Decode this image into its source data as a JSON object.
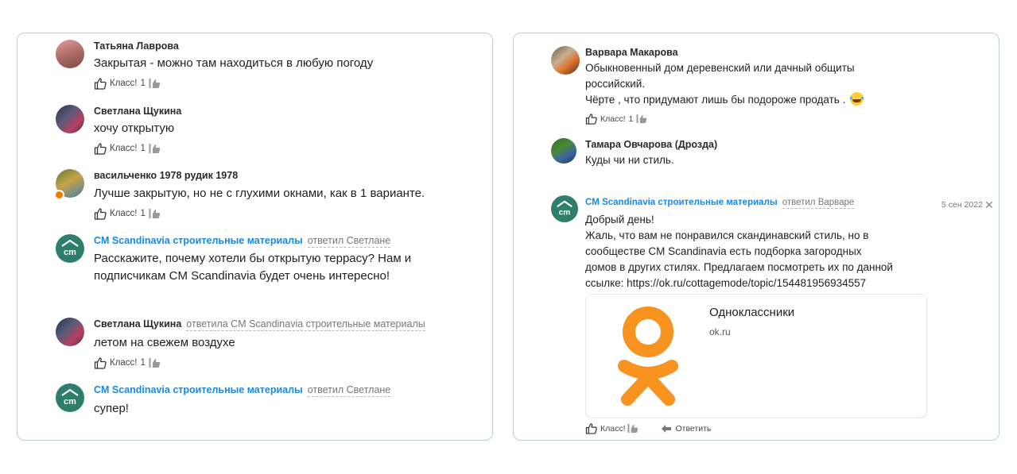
{
  "left": {
    "comments": [
      {
        "author": "Татьяна Лаврова",
        "reply_to": "",
        "text": "Закрытая - можно там находиться в любую погоду",
        "like_label": "Класс!",
        "like_count": "1"
      },
      {
        "author": "Светлана Щукина",
        "reply_to": "",
        "text": "хочу открытую",
        "like_label": "Класс!",
        "like_count": "1"
      },
      {
        "author": "васильченко 1978 рудик 1978",
        "reply_to": "",
        "text": "Лучше закрытую, но не с глухими окнами, как в 1 варианте.",
        "like_label": "Класс!",
        "like_count": "1"
      },
      {
        "author": "CM Scandinavia строительные материалы",
        "reply_to": "ответил Светлане",
        "text_lines": [
          "Расскажите, почему хотели бы открытую террасу? Нам и",
          "подписчикам CM Scandinavia будет очень интересно!"
        ]
      },
      {
        "author": "Светлана Щукина",
        "reply_to": "ответила CM Scandinavia строительные материалы",
        "text": "летом на свежем воздухе",
        "like_label": "Класс!",
        "like_count": "1"
      },
      {
        "author": "CM Scandinavia строительные материалы",
        "reply_to": "ответил Светлане",
        "text": "супер!"
      }
    ]
  },
  "right": {
    "comments": [
      {
        "author": "Варвара Макарова",
        "text_lines": [
          "Обыкновенный дом деревенский или дачный общиты",
          "российский.",
          "Чёрте , что придумают лишь бы подороже продать ."
        ],
        "like_label": "Класс!",
        "like_count": "1"
      },
      {
        "author": "Тамара Овчарова (Дрозда)",
        "text": "Куды чи ни стиль."
      },
      {
        "author": "CM Scandinavia строительные материалы",
        "reply_to": "ответил Варваре",
        "date": "5 сен 2022",
        "close": "✕",
        "text_lines": [
          "Добрый день!",
          "Жаль, что вам не понравился скандинавский стиль, но в",
          "сообществе CM Scandinavia есть подборка загородных",
          "домов в других стилях. Предлагаем посмотреть их по данной",
          "ссылке: https://ok.ru/cottagemode/topic/154481956934557"
        ],
        "card": {
          "title": "Одноклассники",
          "domain": "ok.ru"
        },
        "like_label": "Класс!",
        "reply_label": "Ответить"
      }
    ]
  },
  "avatar_logo_text": "cm",
  "colors": {
    "brand_author": "#1a88e6",
    "panel_border": "#b9cfd6",
    "brand_avatar": "#2f7d6c",
    "ok_orange": "#f7931e"
  },
  "icons": [
    "thumb-up-icon",
    "likers-icon",
    "reply-arrow-icon",
    "close-icon",
    "laughing-emoji-icon",
    "odnoklassniki-logo-icon"
  ]
}
